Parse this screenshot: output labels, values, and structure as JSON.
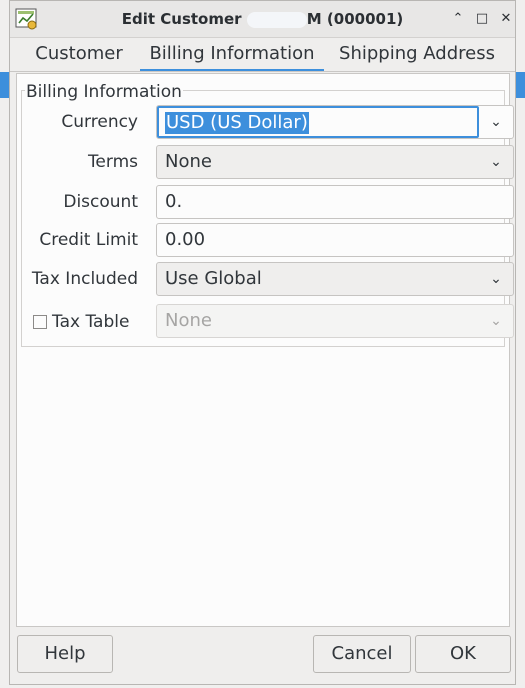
{
  "window": {
    "title_prefix": "Edit Customer",
    "title_suffix": "M (000001)",
    "app_icon": "gnucash-icon",
    "buttons": [
      "shade-icon",
      "maximize-icon",
      "close-icon"
    ],
    "shade_glyph": "⌃",
    "maximize_glyph": "□",
    "close_glyph": "✕"
  },
  "tabs": [
    {
      "label": "Customer",
      "active": false
    },
    {
      "label": "Billing Information",
      "active": true
    },
    {
      "label": "Shipping Address",
      "active": false
    }
  ],
  "billing": {
    "group_title": "Billing Information",
    "currency": {
      "label": "Currency",
      "value": "USD (US Dollar)",
      "selected": true
    },
    "terms": {
      "label": "Terms",
      "value": "None"
    },
    "discount": {
      "label": "Discount",
      "value": "0."
    },
    "credit_limit": {
      "label": "Credit Limit",
      "value": "0.00"
    },
    "tax_included": {
      "label": "Tax Included",
      "value": "Use Global"
    },
    "tax_table": {
      "label": "Tax Table",
      "checked": false,
      "value": "None",
      "enabled": false
    }
  },
  "footer": {
    "help": "Help",
    "cancel": "Cancel",
    "ok": "OK"
  },
  "colors": {
    "accent": "#3d8fdc",
    "window_bg": "#efeeed",
    "panel_bg": "#fcfcfc"
  },
  "chevron_glyph": "⌄"
}
